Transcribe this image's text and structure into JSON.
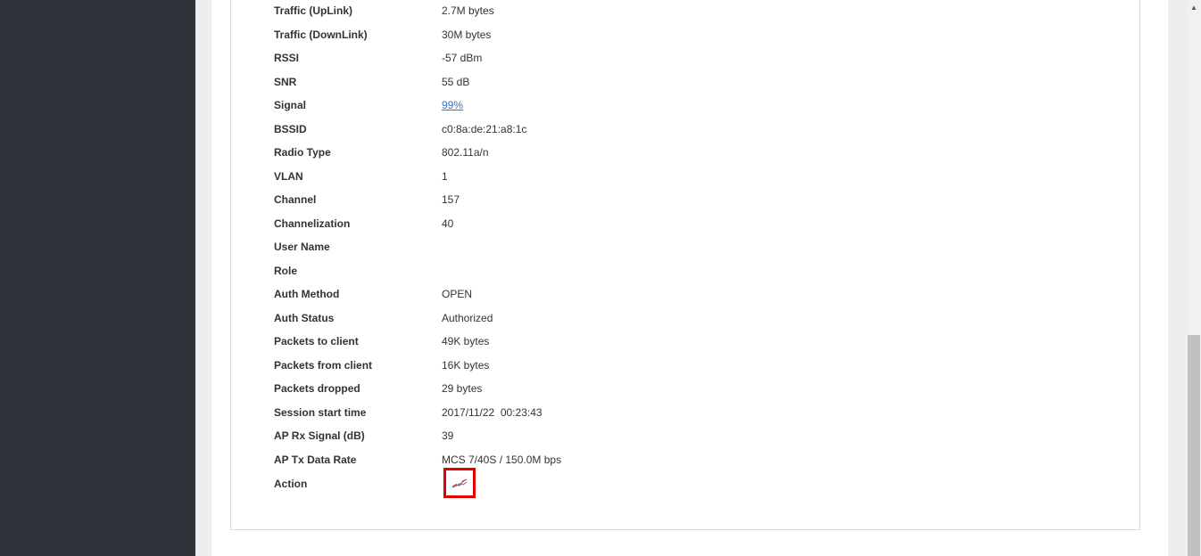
{
  "client_details": {
    "rows": [
      {
        "label": "Traffic (UpLink)",
        "value": "2.7M bytes"
      },
      {
        "label": "Traffic (DownLink)",
        "value": "30M bytes"
      },
      {
        "label": "RSSI",
        "value": "-57 dBm"
      },
      {
        "label": "SNR",
        "value": "55 dB"
      },
      {
        "label": "Signal",
        "value": "99%"
      },
      {
        "label": "BSSID",
        "value": "c0:8a:de:21:a8:1c"
      },
      {
        "label": "Radio Type",
        "value": "802.11a/n"
      },
      {
        "label": "VLAN",
        "value": "1"
      },
      {
        "label": "Channel",
        "value": "157"
      },
      {
        "label": "Channelization",
        "value": "40"
      },
      {
        "label": "User Name",
        "value": ""
      },
      {
        "label": "Role",
        "value": ""
      },
      {
        "label": "Auth Method",
        "value": "OPEN"
      },
      {
        "label": "Auth Status",
        "value": "Authorized"
      },
      {
        "label": "Packets to client",
        "value": "49K bytes"
      },
      {
        "label": "Packets from client",
        "value": "16K bytes"
      },
      {
        "label": "Packets dropped",
        "value": "29 bytes"
      },
      {
        "label": "Session start time",
        "value": "2017/11/22  00:23:43"
      },
      {
        "label": "AP Rx Signal (dB)",
        "value": "39"
      },
      {
        "label": "AP Tx Data Rate",
        "value": "MCS 7/40S / 150.0M bps"
      },
      {
        "label": "Action",
        "value": ""
      }
    ],
    "action_icon": "chart-trend-icon"
  },
  "colors": {
    "sidebar": "#2d3338",
    "link": "#3a73b4",
    "highlight": "#e00000"
  }
}
